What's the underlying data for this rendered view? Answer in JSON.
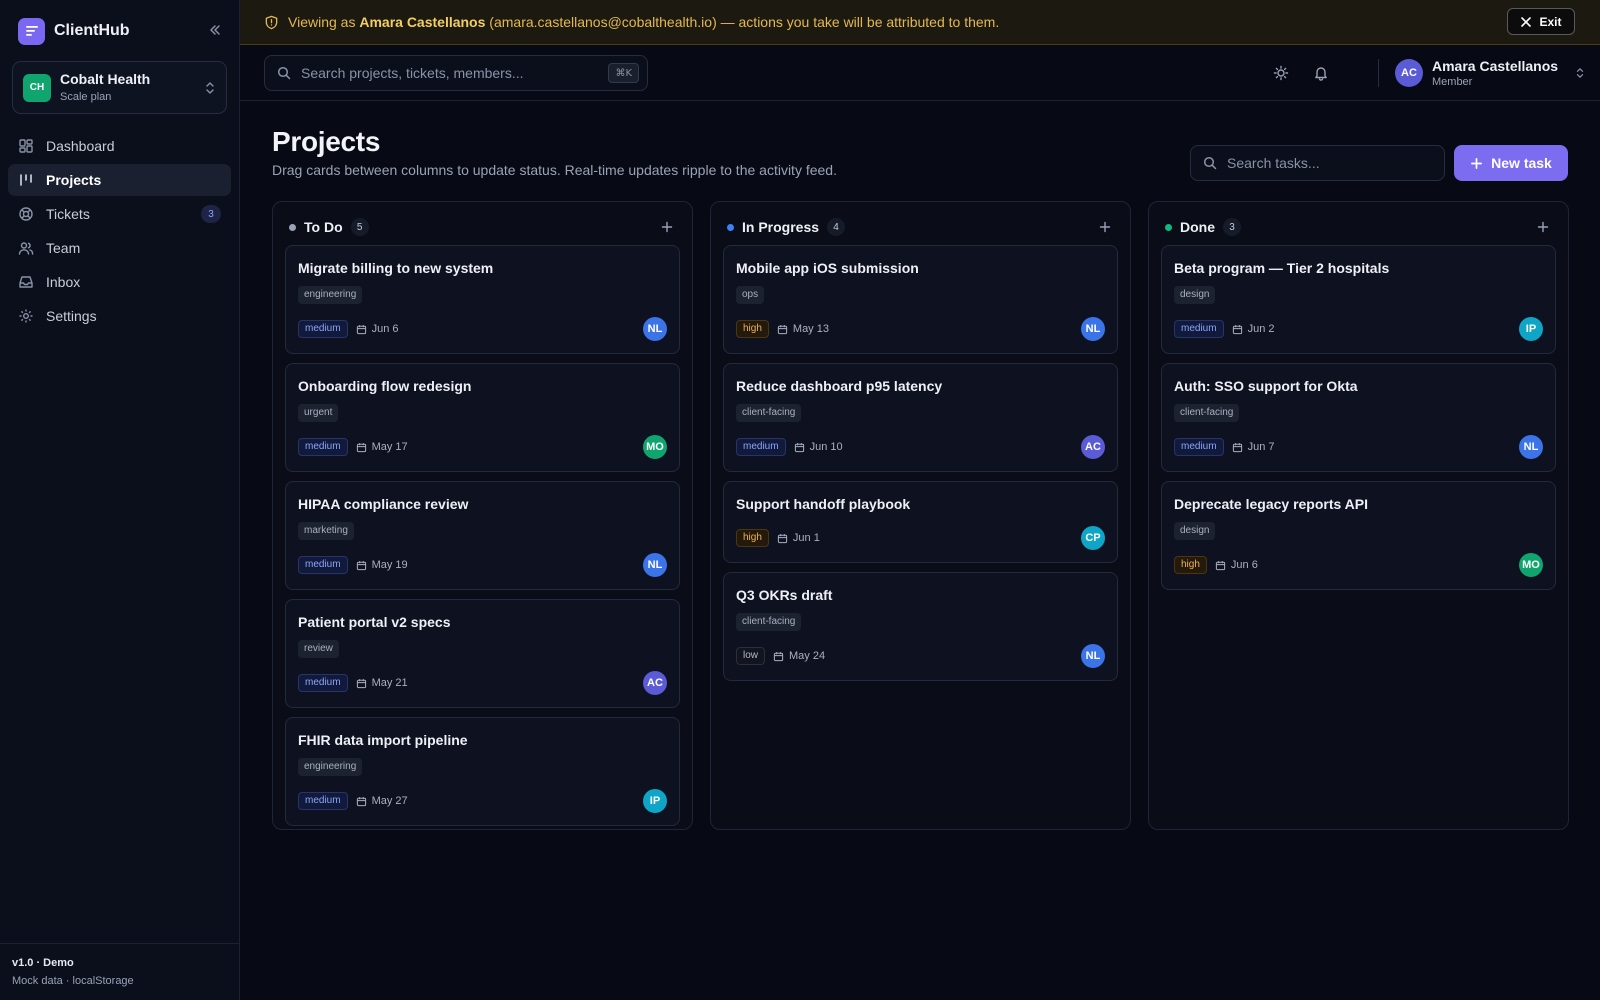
{
  "brand": {
    "name": "ClientHub"
  },
  "org": {
    "initials": "CH",
    "name": "Cobalt Health",
    "plan": "Scale plan"
  },
  "nav": {
    "items": [
      {
        "label": "Dashboard",
        "icon": "dashboard-icon"
      },
      {
        "label": "Projects",
        "icon": "projects-icon",
        "active": true
      },
      {
        "label": "Tickets",
        "icon": "tickets-icon",
        "badge": "3"
      },
      {
        "label": "Team",
        "icon": "team-icon"
      },
      {
        "label": "Inbox",
        "icon": "inbox-icon"
      },
      {
        "label": "Settings",
        "icon": "settings-icon"
      }
    ]
  },
  "footer": {
    "version": "v1.0 · Demo",
    "note": "Mock data · localStorage"
  },
  "banner": {
    "prefix": "Viewing as ",
    "name": "Amara Castellanos",
    "suffix": " (amara.castellanos@cobalthealth.io) — actions you take will be attributed to them.",
    "exit_label": "Exit"
  },
  "topbar": {
    "search_placeholder": "Search projects, tickets, members...",
    "shortcut": "⌘K",
    "user": {
      "initials": "AC",
      "name": "Amara Castellanos",
      "role": "Member"
    }
  },
  "page": {
    "title": "Projects",
    "subtitle": "Drag cards between columns to update status. Real-time updates ripple to the activity feed.",
    "task_search_placeholder": "Search tasks...",
    "new_task_label": "New task"
  },
  "colors": {
    "accent": "#7c6cf0",
    "todo_dot": "#9aa3b5",
    "inprogress_dot": "#3b82f6",
    "done_dot": "#10b981",
    "avatar_NL": "#3b73e8",
    "avatar_MO": "#10a56f",
    "avatar_AC": "#5b5bd6",
    "avatar_IP": "#0ea5c6",
    "avatar_CP": "#0ea5c6"
  },
  "board": {
    "columns": [
      {
        "key": "todo",
        "title": "To Do",
        "count": "5",
        "cards": [
          {
            "title": "Migrate billing to new system",
            "tag": "engineering",
            "priority": "medium",
            "due": "Jun 6",
            "assignee": "NL"
          },
          {
            "title": "Onboarding flow redesign",
            "tag": "urgent",
            "priority": "medium",
            "due": "May 17",
            "assignee": "MO"
          },
          {
            "title": "HIPAA compliance review",
            "tag": "marketing",
            "priority": "medium",
            "due": "May 19",
            "assignee": "NL"
          },
          {
            "title": "Patient portal v2 specs",
            "tag": "review",
            "priority": "medium",
            "due": "May 21",
            "assignee": "AC"
          },
          {
            "title": "FHIR data import pipeline",
            "tag": "engineering",
            "priority": "medium",
            "due": "May 27",
            "assignee": "IP"
          }
        ]
      },
      {
        "key": "inprogress",
        "title": "In Progress",
        "count": "4",
        "cards": [
          {
            "title": "Mobile app iOS submission",
            "tag": "ops",
            "priority": "high",
            "due": "May 13",
            "assignee": "NL"
          },
          {
            "title": "Reduce dashboard p95 latency",
            "tag": "client-facing",
            "priority": "medium",
            "due": "Jun 10",
            "assignee": "AC"
          },
          {
            "title": "Support handoff playbook",
            "tag": "",
            "priority": "high",
            "due": "Jun 1",
            "assignee": "CP"
          },
          {
            "title": "Q3 OKRs draft",
            "tag": "client-facing",
            "priority": "low",
            "due": "May 24",
            "assignee": "NL"
          }
        ]
      },
      {
        "key": "done",
        "title": "Done",
        "count": "3",
        "cards": [
          {
            "title": "Beta program — Tier 2 hospitals",
            "tag": "design",
            "priority": "medium",
            "due": "Jun 2",
            "assignee": "IP"
          },
          {
            "title": "Auth: SSO support for Okta",
            "tag": "client-facing",
            "priority": "medium",
            "due": "Jun 7",
            "assignee": "NL"
          },
          {
            "title": "Deprecate legacy reports API",
            "tag": "design",
            "priority": "high",
            "due": "Jun 6",
            "assignee": "MO"
          }
        ]
      }
    ]
  }
}
